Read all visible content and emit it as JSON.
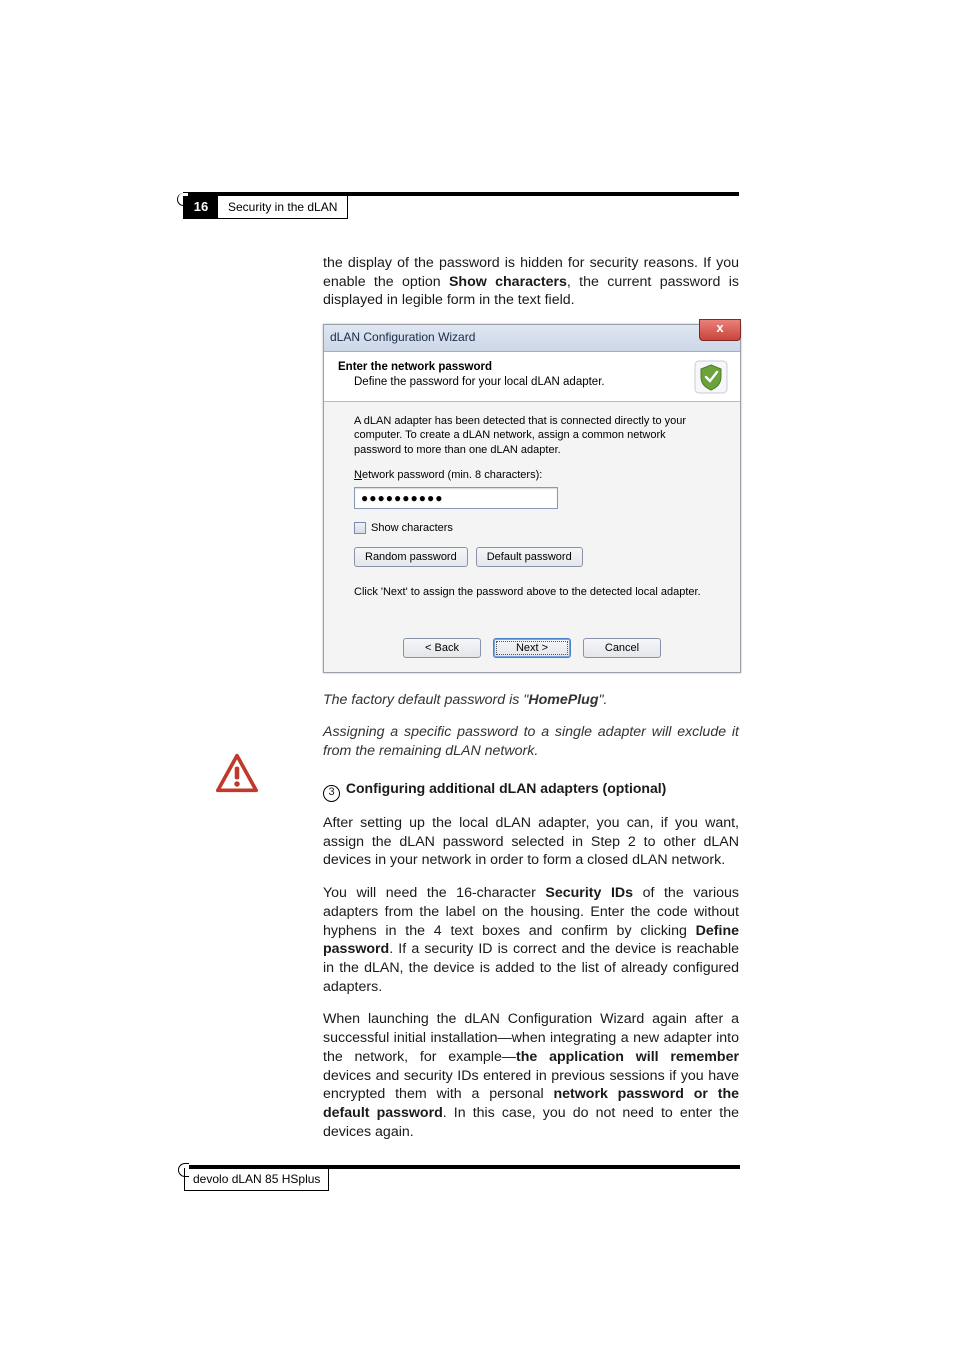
{
  "header": {
    "page_number": "16",
    "section_title": "Security in the dLAN"
  },
  "body": {
    "intro": "the display of the password is hidden for security reasons. If you enable the option ",
    "intro_bold": "Show characters",
    "intro_tail": ", the current password is displayed in legible form in the text field.",
    "default_pw_lead": "The factory default password is \"",
    "default_pw_val": "HomePlug",
    "default_pw_tail": "\".",
    "warn_para": "Assigning a specific password to a single adapter will exclude it from the remaining dLAN network.",
    "step3_num": "3",
    "step3_heading": "Configuring additional dLAN adapters (optional)",
    "para3": "After setting up the local dLAN adapter, you can, if you want, assign the dLAN password selected in Step 2 to other dLAN devices in your network in order to form a closed dLAN network.",
    "para4a": "You will need the 16-character ",
    "para4_b1": "Security IDs",
    "para4b": " of the various adapters from the label on the housing. Enter the code without hyphens in the 4 text boxes and confirm by clicking ",
    "para4_b2": "Define password",
    "para4c": ". If a security ID is correct and the device is reachable in the dLAN, the device is added to the list of already configured adapters.",
    "para5a": "When launching the dLAN Configuration Wizard again after a successful initial installation—when integrating a new adapter into the network, for example—",
    "para5_b1": "the application will remember",
    "para5b": " devices and security IDs entered in previous sessions if you have encrypted them with a personal ",
    "para5_b2": "network password or the default password",
    "para5c": ". In this case, you do not need to enter the devices again."
  },
  "dialog": {
    "title": "dLAN Configuration Wizard",
    "close_glyph": "x",
    "hdr_line1": "Enter the network password",
    "hdr_line2": "Define the password for your local dLAN adapter.",
    "detect_text": "A dLAN adapter has been detected that is connected directly to your computer. To create a dLAN network, assign a common network password to more than one dLAN adapter.",
    "field_label_pre": "N",
    "field_label_rest": "etwork password (min. 8 characters):",
    "password_mask": "●●●●●●●●●●",
    "show_chars_label": "Show characters",
    "random_btn": "Random password",
    "default_btn": "Default password",
    "click_next": "Click 'Next' to assign the password above to the detected local adapter.",
    "back_btn": "< Back",
    "next_btn": "Next >",
    "cancel_btn": "Cancel"
  },
  "footer": {
    "product": "devolo dLAN 85 HSplus"
  }
}
